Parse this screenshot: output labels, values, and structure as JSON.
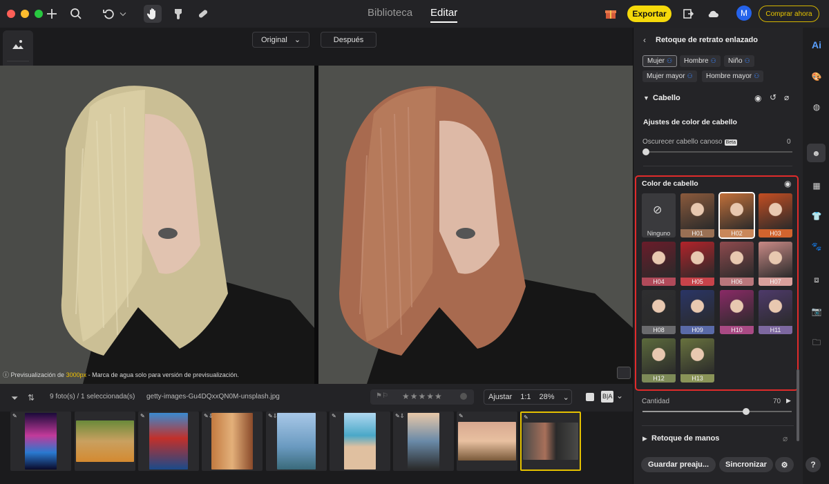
{
  "topbar": {
    "tabs": [
      {
        "label": "Biblioteca"
      },
      {
        "label": "Editar"
      }
    ],
    "export_label": "Exportar",
    "avatar_initial": "M",
    "buy_label": "Comprar ahora",
    "accent": "#f5d90a"
  },
  "preview": {
    "original_label": "Original",
    "after_label": "Después",
    "watermark_prefix": "Previsualización de ",
    "watermark_size": "3000px",
    "watermark_suffix": " - Marca de agua solo para versión de previsualización."
  },
  "filmbar": {
    "count_text": "9 foto(s) / 1 seleccionada(s)",
    "filename": "getty-images-Gu4DQxxQN0M-unsplash.jpg",
    "fit_label": "Ajustar",
    "ratio_label": "1:1",
    "zoom": "28%",
    "ba_label": "B|A"
  },
  "filmstrip": {
    "thumbs": [
      {
        "name": "neon-sign"
      },
      {
        "name": "puppies"
      },
      {
        "name": "red-building-water"
      },
      {
        "name": "street-buildings"
      },
      {
        "name": "city-tower"
      },
      {
        "name": "beach-crowd"
      },
      {
        "name": "coast-rocks"
      },
      {
        "name": "hot-air-balloon"
      },
      {
        "name": "portrait-woman"
      }
    ]
  },
  "panel": {
    "title": "Retoque de retrato enlazado",
    "chips": [
      {
        "label": "Mujer"
      },
      {
        "label": "Hombre"
      },
      {
        "label": "Niño"
      },
      {
        "label": "Mujer mayor"
      },
      {
        "label": "Hombre mayor"
      }
    ],
    "hair_section": "Cabello",
    "hair_color_adjust": "Ajustes de color de cabello",
    "gray_label": "Oscurecer cabello canoso",
    "beta": "Beta",
    "gray_value": "0",
    "hair_color_title": "Color de cabello",
    "none_label": "Ninguno",
    "swatches": [
      {
        "label": "H01",
        "color": "#8b5a3c",
        "band": "#9a7054"
      },
      {
        "label": "H02",
        "color": "#c2703a",
        "band": "#c9875a"
      },
      {
        "label": "H03",
        "color": "#c44e22",
        "band": "#d2642e"
      },
      {
        "label": "H04",
        "color": "#6a1c2a",
        "band": "#b04a5a"
      },
      {
        "label": "H05",
        "color": "#b2232a",
        "band": "#c8434a"
      },
      {
        "label": "H06",
        "color": "#8e4a4e",
        "band": "#b9777c"
      },
      {
        "label": "H07",
        "color": "#c98a86",
        "band": "#d9a09c"
      },
      {
        "label": "H08",
        "color": "#2e2e30",
        "band": "#6a6a6d"
      },
      {
        "label": "H09",
        "color": "#2a3566",
        "band": "#5a6aa8"
      },
      {
        "label": "H10",
        "color": "#8a2a66",
        "band": "#a94a84"
      },
      {
        "label": "H11",
        "color": "#4e3a6a",
        "band": "#7d68a0"
      },
      {
        "label": "H12",
        "color": "#5c6a3c",
        "band": "#7d8a58"
      },
      {
        "label": "H13",
        "color": "#68723e",
        "band": "#8a9458"
      }
    ],
    "amount_label": "Cantidad",
    "amount_value": "70",
    "hands_section": "Retoque de manos",
    "save_preset": "Guardar preaju...",
    "sync": "Sincronizar",
    "highlight_color": "#e12b2b"
  },
  "rail": {
    "ai_label": "Ai",
    "help": "?"
  }
}
